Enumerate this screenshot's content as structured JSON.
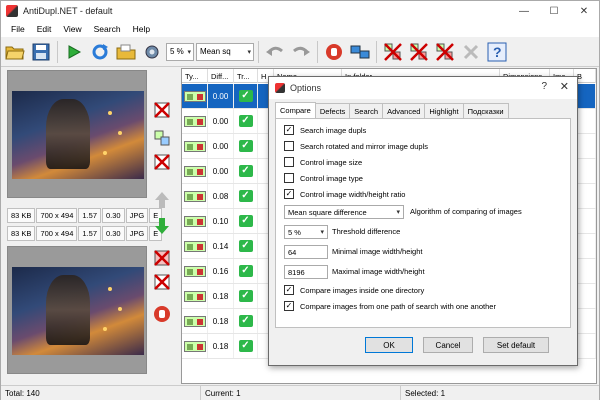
{
  "window": {
    "title": "AntiDupl.NET - default"
  },
  "menu": [
    "File",
    "Edit",
    "View",
    "Search",
    "Help"
  ],
  "toolbar": {
    "threshold": "5 %",
    "algorithm": "Mean sq"
  },
  "preview": {
    "top_info": [
      "83 KB",
      "700 x 494",
      "1.57",
      "0.30",
      "JPG",
      "E"
    ],
    "bottom_info": [
      "83 KB",
      "700 x 494",
      "1.57",
      "0.30",
      "JPG",
      "E"
    ]
  },
  "table": {
    "headers": [
      "Ty...",
      "Diff...",
      "Tr...",
      "H",
      "Name",
      "In folder",
      "Dimensions",
      "Ima",
      "B"
    ],
    "rows": [
      {
        "diff": "0.00",
        "selected": true
      },
      {
        "diff": "0.00"
      },
      {
        "diff": "0.00"
      },
      {
        "diff": "0.00"
      },
      {
        "diff": "0.08"
      },
      {
        "diff": "0.10"
      },
      {
        "diff": "0.14"
      },
      {
        "diff": "0.16"
      },
      {
        "diff": "0.18"
      },
      {
        "diff": "0.18"
      },
      {
        "diff": "0.18"
      }
    ]
  },
  "status": {
    "total": "Total: 140",
    "current": "Current: 1",
    "selected": "Selected: 1"
  },
  "dialog": {
    "title": "Options",
    "tabs": [
      "Compare",
      "Defects",
      "Search",
      "Advanced",
      "Highlight",
      "Подсказки"
    ],
    "options": [
      {
        "label": "Search image dupls",
        "checked": true
      },
      {
        "label": "Search rotated and mirror image dupls",
        "checked": false
      },
      {
        "label": "Control image size",
        "checked": false
      },
      {
        "label": "Control image type",
        "checked": false
      },
      {
        "label": "Control image width/height ratio",
        "checked": true
      }
    ],
    "algorithm": {
      "value": "Mean square difference",
      "label": "Algorithm of comparing of images"
    },
    "threshold": {
      "value": "5 %",
      "label": "Threshold difference"
    },
    "min_size": {
      "value": "64",
      "label": "Minimal image width/height"
    },
    "max_size": {
      "value": "8196",
      "label": "Maximal image width/height"
    },
    "options2": [
      {
        "label": "Compare images inside one directory",
        "checked": true
      },
      {
        "label": "Compare images from one path of search with one another",
        "checked": true
      }
    ],
    "ok": "OK",
    "cancel": "Cancel",
    "set_default": "Set default"
  }
}
